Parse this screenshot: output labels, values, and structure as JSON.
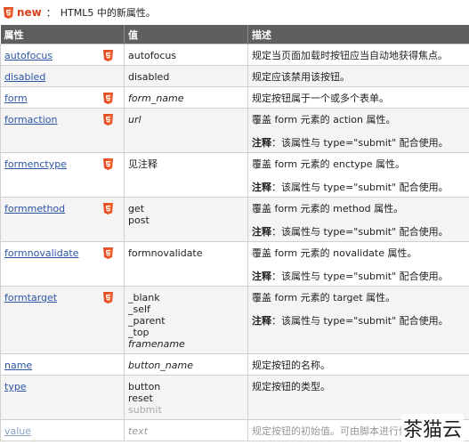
{
  "header": {
    "new_label": "new",
    "separator": "：",
    "description": "HTML5 中的新属性。"
  },
  "table": {
    "columns": [
      "属性",
      "值",
      "描述"
    ],
    "rows": [
      {
        "attr": "autofocus",
        "html5": true,
        "values": [
          "autofocus"
        ],
        "italic": false,
        "desc": [
          "规定当页面加载时按钮应当自动地获得焦点。"
        ]
      },
      {
        "attr": "disabled",
        "html5": false,
        "values": [
          "disabled"
        ],
        "italic": false,
        "desc": [
          "规定应该禁用该按钮。"
        ]
      },
      {
        "attr": "form",
        "html5": true,
        "values": [
          "form_name"
        ],
        "italic": true,
        "desc": [
          "规定按钮属于一个或多个表单。"
        ]
      },
      {
        "attr": "formaction",
        "html5": true,
        "values": [
          "url"
        ],
        "italic": true,
        "desc": [
          "覆盖 form 元素的 action 属性。",
          "注释：该属性与 type=\"submit\" 配合使用。"
        ]
      },
      {
        "attr": "formenctype",
        "html5": true,
        "values": [
          "见注释"
        ],
        "italic": false,
        "desc": [
          "覆盖 form 元素的 enctype 属性。",
          "注释：该属性与 type=\"submit\" 配合使用。"
        ]
      },
      {
        "attr": "formmethod",
        "html5": true,
        "values": [
          "get",
          "post"
        ],
        "italic": false,
        "desc": [
          "覆盖 form 元素的 method 属性。",
          "注释：该属性与 type=\"submit\" 配合使用。"
        ]
      },
      {
        "attr": "formnovalidate",
        "html5": true,
        "values": [
          "formnovalidate"
        ],
        "italic": false,
        "desc": [
          "覆盖 form 元素的 novalidate 属性。",
          "注释：该属性与 type=\"submit\" 配合使用。"
        ]
      },
      {
        "attr": "formtarget",
        "html5": true,
        "values": [
          "_blank",
          "_self",
          "_parent",
          "_top",
          "framename"
        ],
        "italic_last": true,
        "italic": false,
        "desc": [
          "覆盖 form 元素的 target 属性。",
          "注释：该属性与 type=\"submit\" 配合使用。"
        ]
      },
      {
        "attr": "name",
        "html5": false,
        "values": [
          "button_name"
        ],
        "italic": true,
        "desc": [
          "规定按钮的名称。"
        ]
      },
      {
        "attr": "type",
        "html5": false,
        "values": [
          "button",
          "reset",
          "submit"
        ],
        "italic": false,
        "desc": [
          "规定按钮的类型。"
        ]
      },
      {
        "attr": "value",
        "html5": false,
        "values": [
          "text"
        ],
        "italic": true,
        "desc": [
          "规定按钮的初始值。可由脚本进行修"
        ]
      }
    ]
  },
  "note_label": "注释",
  "watermark": "茶猫云",
  "colors": {
    "header_bg": "#5f5f5f",
    "link": "#2b55a5",
    "new": "#d9411e",
    "badge": "#e44d26"
  }
}
